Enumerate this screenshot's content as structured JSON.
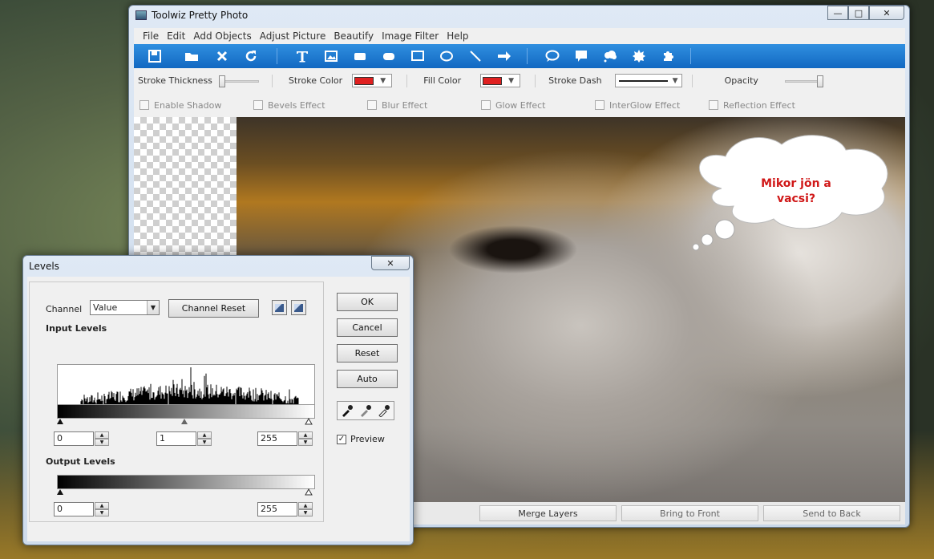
{
  "window": {
    "title": "Toolwiz Pretty Photo",
    "min": "—",
    "max": "□",
    "close": "✕"
  },
  "menu": [
    "File",
    "Edit",
    "Add Objects",
    "Adjust Picture",
    "Beautify",
    "Image Filter",
    "Help"
  ],
  "toolbar": {
    "icons": [
      "save-icon",
      "open-folder-icon",
      "delete-icon",
      "refresh-icon",
      "text-icon",
      "image-icon",
      "rectangle-icon",
      "rounded-rectangle-icon",
      "square-icon",
      "ellipse-icon",
      "line-icon",
      "arrow-icon",
      "speech-bubble-icon",
      "rectangle-callout-icon",
      "cloud-callout-icon",
      "burst-icon",
      "puzzle-icon"
    ]
  },
  "properties": {
    "stroke_thickness": "Stroke Thickness",
    "stroke_color": "Stroke Color",
    "fill_color": "Fill Color",
    "stroke_dash": "Stroke Dash",
    "opacity": "Opacity",
    "stroke_color_value": "#e02020",
    "fill_color_value": "#e02020"
  },
  "effects": [
    "Enable Shadow",
    "Bevels Effect",
    "Blur Effect",
    "Glow Effect",
    "InterGlow Effect",
    "Reflection Effect"
  ],
  "bubble": {
    "line1": "Mikor jön a",
    "line2": "vacsi?"
  },
  "bottom": {
    "merge": "Merge Layers",
    "front": "Bring to Front",
    "back": "Send to Back"
  },
  "levels": {
    "title": "Levels",
    "close": "✕",
    "channel_label": "Channel",
    "channel_value": "Value",
    "channel_reset": "Channel Reset",
    "input_levels": "Input Levels",
    "output_levels": "Output Levels",
    "input_black": "0",
    "input_gamma": "1",
    "input_white": "255",
    "output_black": "0",
    "output_white": "255",
    "ok": "OK",
    "cancel": "Cancel",
    "reset": "Reset",
    "auto": "Auto",
    "preview": "Preview",
    "preview_checked": true
  }
}
